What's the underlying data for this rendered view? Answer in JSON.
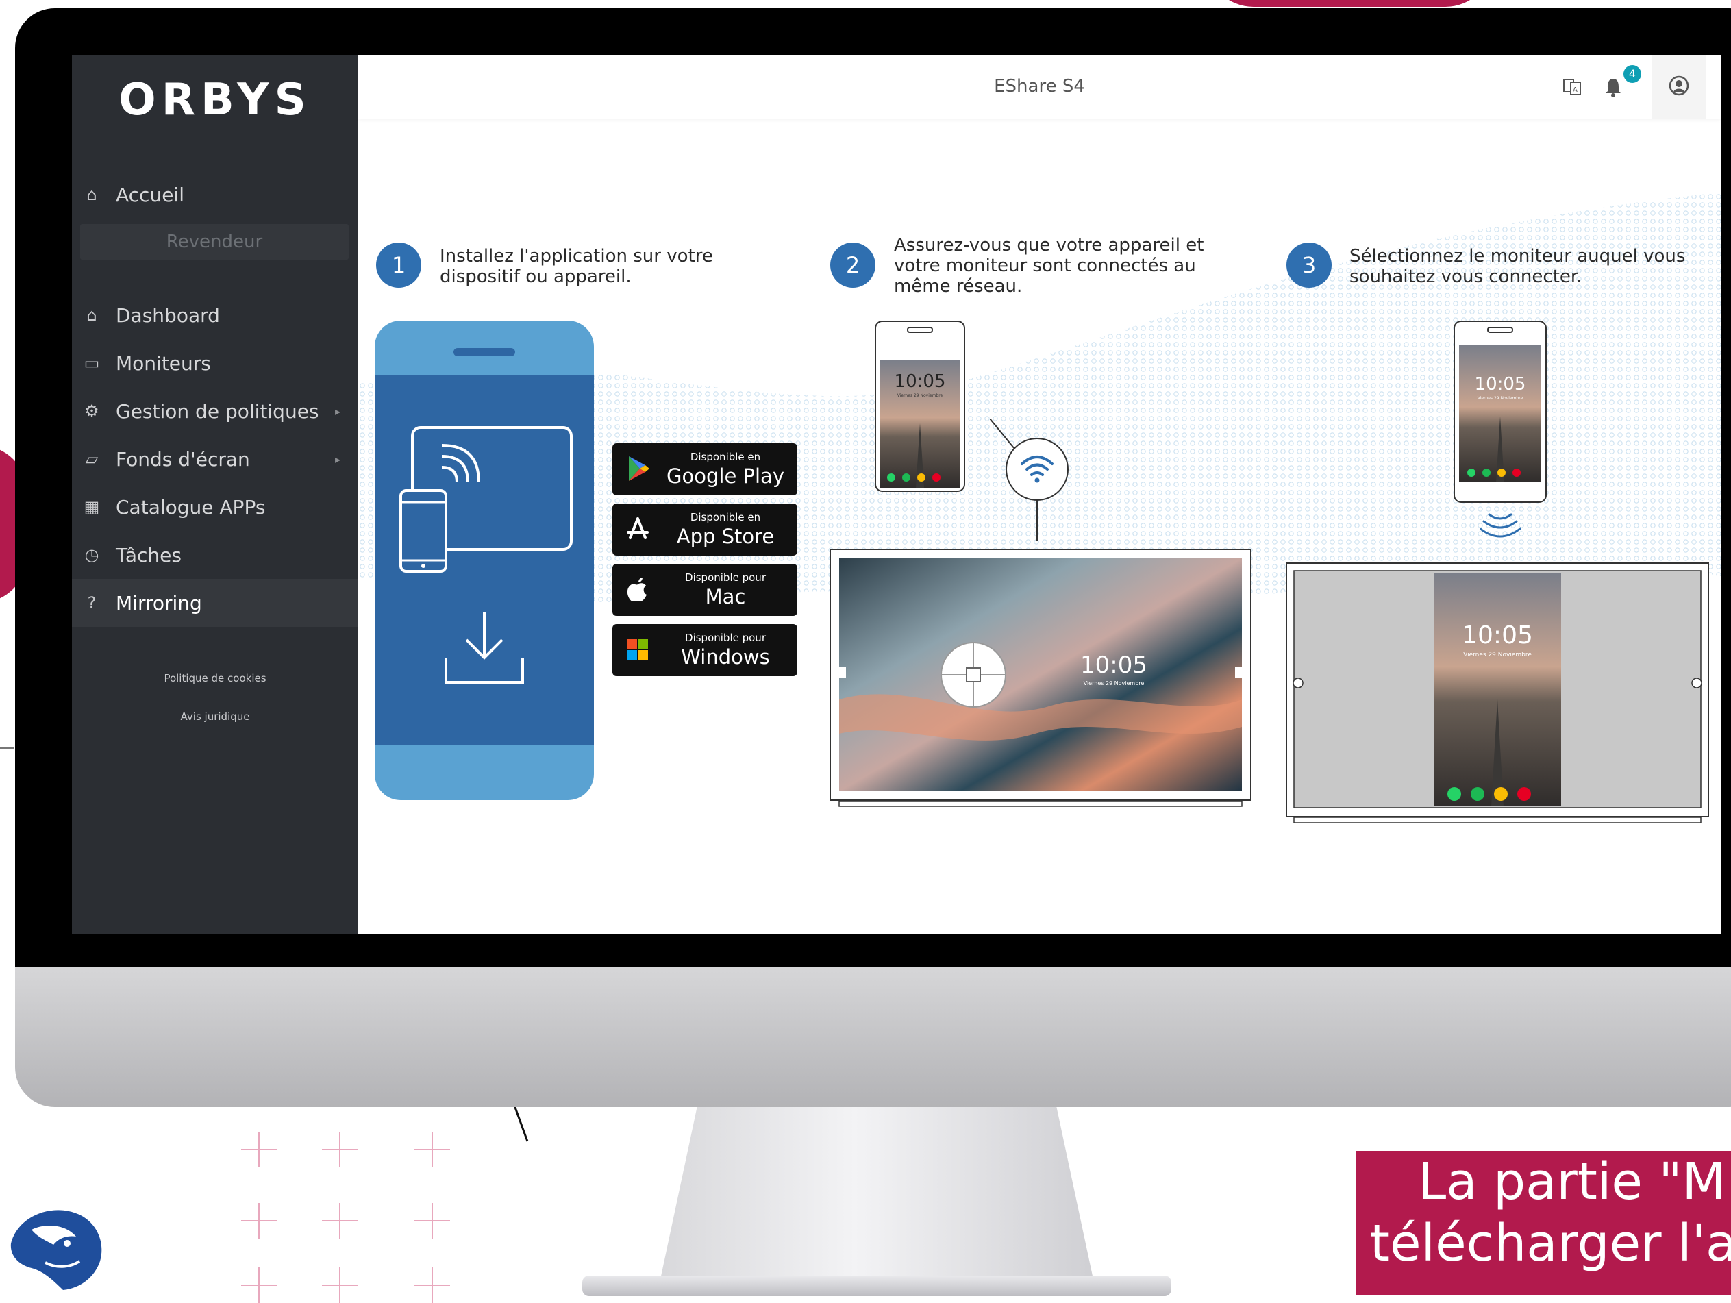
{
  "app": {
    "logo": "ORBYS",
    "title": "EShare S4",
    "notification_count": "4"
  },
  "sidebar": {
    "home": "Accueil",
    "section": "Revendeur",
    "items": [
      {
        "label": "Dashboard",
        "icon": "home-icon"
      },
      {
        "label": "Moniteurs",
        "icon": "monitor-icon"
      },
      {
        "label": "Gestion de politiques",
        "icon": "cogs-icon",
        "has_submenu": true
      },
      {
        "label": "Fonds d'écran",
        "icon": "folder-icon",
        "has_submenu": true
      },
      {
        "label": "Catalogue APPs",
        "icon": "grid-icon"
      },
      {
        "label": "Tâches",
        "icon": "clock-icon"
      },
      {
        "label": "Mirroring",
        "icon": "question-icon",
        "active": true
      }
    ],
    "footer": {
      "cookies": "Politique de cookies",
      "legal": "Avis juridique"
    }
  },
  "steps": [
    {
      "number": "1",
      "text": "Installez l'application sur votre dispositif ou appareil."
    },
    {
      "number": "2",
      "text": "Assurez-vous que votre appareil et votre moniteur sont connectés au même réseau."
    },
    {
      "number": "3",
      "text": "Sélectionnez le moniteur auquel vous souhaitez vous connecter."
    }
  ],
  "stores": [
    {
      "small": "Disponible en",
      "big": "Google Play",
      "icon": "google-play-icon"
    },
    {
      "small": "Disponible en",
      "big": "App Store",
      "icon": "app-store-icon"
    },
    {
      "small": "Disponible pour",
      "big": "Mac",
      "icon": "apple-icon"
    },
    {
      "small": "Disponible pour",
      "big": "Windows",
      "icon": "windows-icon"
    }
  ],
  "lockscreen": {
    "time": "10:05",
    "date": "Viernes 29 Noviembre"
  },
  "caption": {
    "line1": "La partie \"M",
    "line2": "télécharger l'a"
  },
  "colors": {
    "brand_accent": "#b21a4d",
    "sidebar_bg": "#2b2e33",
    "step_blue": "#2f6fb0",
    "badge": "#0f9fb4"
  }
}
